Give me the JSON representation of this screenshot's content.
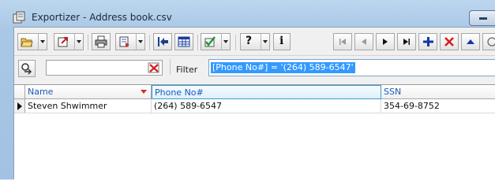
{
  "window": {
    "title": "Exportizer - Address book.csv"
  },
  "toolbar": {
    "buttons": [
      {
        "name": "open-button",
        "icon": "folder-open-icon"
      },
      {
        "name": "export-button",
        "icon": "export-icon"
      },
      {
        "name": "print-button",
        "icon": "printer-icon"
      },
      {
        "name": "copy-button",
        "icon": "copy-icon"
      },
      {
        "name": "first-column-button",
        "icon": "arrow-left-bar-icon"
      },
      {
        "name": "grid-view-button",
        "icon": "grid-icon"
      },
      {
        "name": "check-button",
        "icon": "checkmark-icon"
      },
      {
        "name": "help-button",
        "icon": "question-icon"
      },
      {
        "name": "info-button",
        "icon": "info-icon"
      }
    ],
    "help_label": "?",
    "info_label": "i"
  },
  "navigator": {
    "first": "first-record-icon",
    "prior": "prior-record-icon",
    "next": "next-record-icon",
    "last": "last-record-icon",
    "insert": "insert-icon",
    "delete": "delete-icon",
    "up": "move-up-icon"
  },
  "filter": {
    "label": "Filter",
    "value": "[Phone No#] = '(264) 589-6547'",
    "search_value": ""
  },
  "table": {
    "columns": [
      "Name",
      "Phone No#",
      "SSN"
    ],
    "rows": [
      [
        "Steven Shwimmer",
        "(264) 589-6547",
        "354-69-8752"
      ]
    ]
  }
}
